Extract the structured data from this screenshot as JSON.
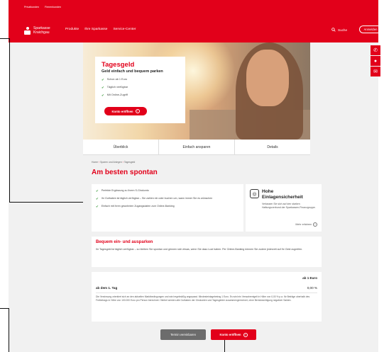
{
  "header": {
    "toplinks": [
      "Privatkunden",
      "Firmenkunden"
    ],
    "logo_line1": "Sparkasse",
    "logo_line2": "Kraichgau",
    "nav": [
      "Produkte",
      "Ihre Sparkasse",
      "Service-Center"
    ],
    "search_label": "Suche",
    "login_label": "Anmelden"
  },
  "side_icons": [
    "phone-icon",
    "chat-icon",
    "mail-icon"
  ],
  "hero": {
    "title": "Tagesgeld",
    "subtitle": "Geld einfach und bequem parken",
    "bullets": [
      "Schon ab 1 Euro",
      "Täglich verfügbar",
      "Mit Online-Zugriff"
    ],
    "button_label": "Konto eröffnen"
  },
  "tabs": [
    "Überblick",
    "Einfach ansparen",
    "Details"
  ],
  "breadcrumb": {
    "items": [
      "Home",
      "Sparen und Anlegen"
    ],
    "current": "Tagesgeld"
  },
  "page_title": "Am besten spontan",
  "benefits": [
    "Perfekte Ergänzung zu Ihrem S-Girokonto",
    "Ihr Guthaben ist täglich verfügbar – Sie zahlen ein oder buchen um, wann immer Sie es wünschen",
    "Einfach mit Ihren gewohnten Zugangsdaten zum Online-Banking"
  ],
  "security": {
    "title_line1": "Hohe",
    "title_line2": "Einlagensicherheit",
    "text": "Verlassen Sie sich auf den starken Haftungsverbund der Sparkassen-Finanzgruppe.",
    "link": "Mehr erfahren"
  },
  "bequem": {
    "title": "Bequem ein- und ausparken",
    "text": "Ihr Tagesgeld ist täglich verfügbar – so bleiben Sie spontan und gönnen sich etwas, wenn Sie dazu Lust haben. Per Online-Banking können Sie zudem jederzeit auf Ihr Geld zugreifen."
  },
  "rates": {
    "header": "ab 1 Euro",
    "row_label": "ab dem 1. Tag",
    "row_value": "0,00 %",
    "note": "Die Verzinsung orientiert sich an den aktuellen Marktbedingungen und wird regelmäßig angepasst. Mindesteinlagebetrag 1 Euro. Es wird ein Verwahrentgelt in Höhe von 0,00 % p.a. für Beträge oberhalb des Freibetrags in Höhe von 100.000 Euro pro Person berechnet. Hierbei werden alle Guthaben der Girokonten und Tagesgelder zusammengerechnet, ohne Berücksichtigung negativer Salden."
  },
  "actions": {
    "appointment_label": "Termin vereinbaren",
    "open_label": "Konto eröffnen"
  }
}
